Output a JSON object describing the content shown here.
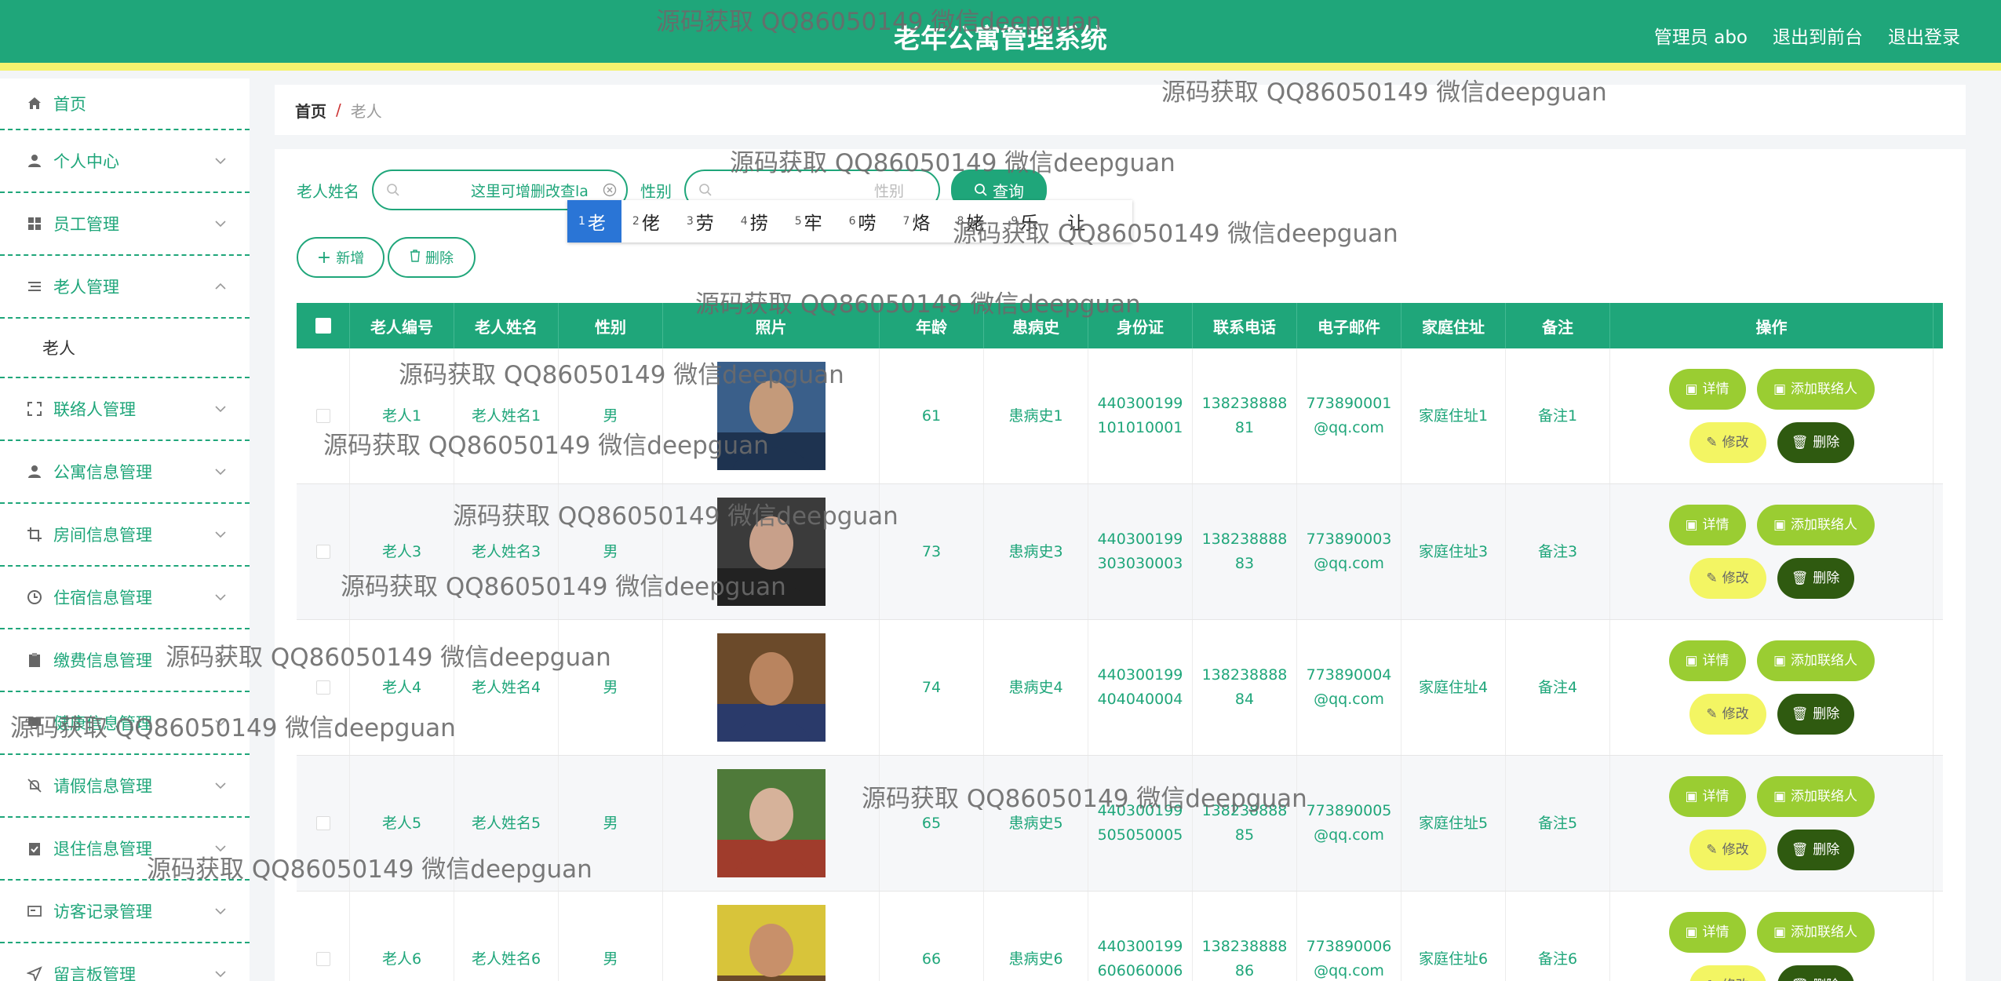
{
  "header": {
    "title": "老年公寓管理系统",
    "user": "管理员 abo",
    "to_front": "退出到前台",
    "logout": "退出登录"
  },
  "sidebar": {
    "items": [
      {
        "label": "首页",
        "icon": "home-icon"
      },
      {
        "label": "个人中心",
        "icon": "person-icon"
      },
      {
        "label": "员工管理",
        "icon": "grid-icon"
      },
      {
        "label": "老人管理",
        "icon": "list-icon",
        "expanded": true,
        "children": [
          "老人"
        ]
      },
      {
        "label": "联络人管理",
        "icon": "scan-icon"
      },
      {
        "label": "公寓信息管理",
        "icon": "person-icon"
      },
      {
        "label": "房间信息管理",
        "icon": "crop-icon"
      },
      {
        "label": "住宿信息管理",
        "icon": "clock-icon"
      },
      {
        "label": "缴费信息管理",
        "icon": "clipboard-icon"
      },
      {
        "label": "健康信息管理",
        "icon": "monitor-icon"
      },
      {
        "label": "请假信息管理",
        "icon": "bell-off-icon"
      },
      {
        "label": "退住信息管理",
        "icon": "clipboard-check-icon"
      },
      {
        "label": "访客记录管理",
        "icon": "card-icon"
      },
      {
        "label": "留言板管理",
        "icon": "send-icon"
      }
    ]
  },
  "breadcrumb": {
    "home": "首页",
    "separator": "/",
    "current": "老人"
  },
  "search": {
    "name_label": "老人姓名",
    "name_value": "这里可增删改查la",
    "sex_label": "性别",
    "sex_placeholder": "性别",
    "query_button": "查询"
  },
  "ime": {
    "candidates": [
      {
        "n": "1",
        "t": "老"
      },
      {
        "n": "2",
        "t": "佬"
      },
      {
        "n": "3",
        "t": "劳"
      },
      {
        "n": "4",
        "t": "捞"
      },
      {
        "n": "5",
        "t": "牢"
      },
      {
        "n": "6",
        "t": "唠"
      },
      {
        "n": "7",
        "t": "烙"
      },
      {
        "n": "8",
        "t": "姥"
      },
      {
        "n": "9",
        "t": "乐"
      },
      {
        "n": "",
        "t": "让"
      }
    ]
  },
  "actions": {
    "add": "新增",
    "delete": "删除"
  },
  "table": {
    "headers": [
      "老人编号",
      "老人姓名",
      "性别",
      "照片",
      "年龄",
      "患病史",
      "身份证",
      "联系电话",
      "电子邮件",
      "家庭住址",
      "备注",
      "操作"
    ],
    "rows": [
      {
        "id": "老人1",
        "name": "老人姓名1",
        "sex": "男",
        "age": "61",
        "history": "患病史1",
        "idcard1": "440300199",
        "idcard2": "101010001",
        "phone1": "138238888",
        "phone2": "81",
        "email1": "773890001",
        "email2": "@qq.com",
        "address": "家庭住址1",
        "note": "备注1"
      },
      {
        "id": "老人3",
        "name": "老人姓名3",
        "sex": "男",
        "age": "73",
        "history": "患病史3",
        "idcard1": "440300199",
        "idcard2": "303030003",
        "phone1": "138238888",
        "phone2": "83",
        "email1": "773890003",
        "email2": "@qq.com",
        "address": "家庭住址3",
        "note": "备注3"
      },
      {
        "id": "老人4",
        "name": "老人姓名4",
        "sex": "男",
        "age": "74",
        "history": "患病史4",
        "idcard1": "440300199",
        "idcard2": "404040004",
        "phone1": "138238888",
        "phone2": "84",
        "email1": "773890004",
        "email2": "@qq.com",
        "address": "家庭住址4",
        "note": "备注4"
      },
      {
        "id": "老人5",
        "name": "老人姓名5",
        "sex": "男",
        "age": "65",
        "history": "患病史5",
        "idcard1": "440300199",
        "idcard2": "505050005",
        "phone1": "138238888",
        "phone2": "85",
        "email1": "773890005",
        "email2": "@qq.com",
        "address": "家庭住址5",
        "note": "备注5"
      },
      {
        "id": "老人6",
        "name": "老人姓名6",
        "sex": "男",
        "age": "66",
        "history": "患病史6",
        "idcard1": "440300199",
        "idcard2": "606060006",
        "phone1": "138238888",
        "phone2": "86",
        "email1": "773890006",
        "email2": "@qq.com",
        "address": "家庭住址6",
        "note": "备注6"
      }
    ],
    "op_labels": {
      "detail": "详情",
      "add_contact": "添加联络人",
      "edit": "修改",
      "delete": "删除"
    }
  },
  "watermark": "源码获取 QQ86050149 微信deepguan",
  "colors": {
    "primary": "#1fa67a",
    "accent_yellow": "#f4f26e",
    "lime": "#9acd32",
    "dark_green": "#2f5a10"
  }
}
